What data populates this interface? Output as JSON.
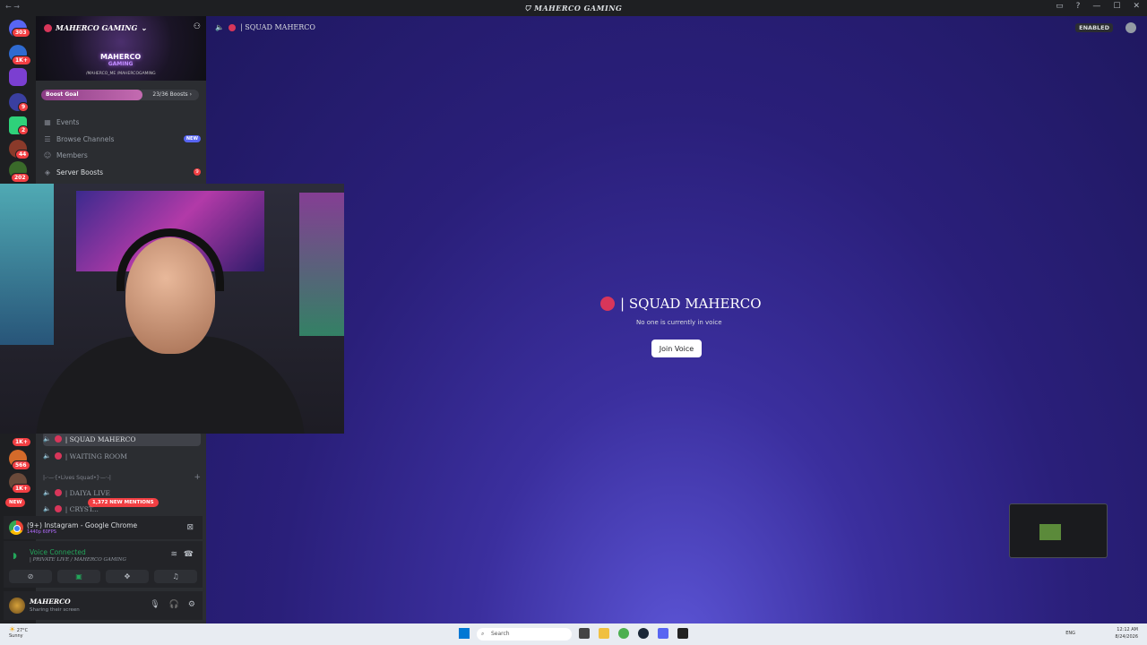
{
  "window": {
    "title": "MAHERCO GAMING"
  },
  "guilds": [
    {
      "badge": "303"
    },
    {
      "badge": "1K+"
    },
    {
      "badge": ""
    },
    {
      "badge": "9"
    },
    {
      "badge": "2"
    },
    {
      "badge": "44"
    },
    {
      "badge": "202"
    },
    {
      "badge": "1K+"
    },
    {
      "badge": "566"
    },
    {
      "badge": "1K+"
    }
  ],
  "server": {
    "name": "MAHERCO GAMING",
    "logo_line1": "MAHERCO",
    "logo_line2": "GAMING",
    "social": "/MAHERCO_ME  /MAHERCOGAMING",
    "boost_goal_label": "Boost Goal",
    "boost_count": "23/36 Boosts",
    "boost_progress": 0.64
  },
  "menu": {
    "events": "Events",
    "browse": "Browse Channels",
    "browse_tag": "NEW",
    "members": "Members",
    "boosts": "Server Boosts",
    "boosts_badge": "9"
  },
  "channels": {
    "squad": "| SQUAD MAHERCO",
    "waiting": "| WAITING ROOM",
    "category": "|-·—·[•Lives Squad•]·—·-|",
    "c1": "| DAIYA LIVE",
    "c2": "| CRYST..."
  },
  "badges": {
    "new": "NEW",
    "mentions": "1,372 NEW MENTIONS"
  },
  "stream": {
    "title": "(9+) Instagram - Google Chrome",
    "quality": "1440p 60FPS"
  },
  "voice": {
    "status": "Voice Connected",
    "channel": "| PRIVATE LIVE / MAHERCO GAMING"
  },
  "user": {
    "name": "MAHERCO",
    "status": "Sharing their screen"
  },
  "main": {
    "header_channel": "| SQUAD MAHERCO",
    "enabled": "ENABLED",
    "title": "| SQUAD MAHERCO",
    "subtitle": "No one is currently in voice",
    "join_label": "Join Voice"
  },
  "taskbar": {
    "temp": "27°C",
    "weather": "Sunny",
    "search_placeholder": "Search",
    "lang": "ENG",
    "time": "12:12 AM",
    "date": "8/24/2026"
  },
  "colors": {
    "accent": "#5865f2",
    "voice_green": "#23a55a",
    "alert_red": "#f23f43",
    "channel_dot": "#d8365a"
  }
}
